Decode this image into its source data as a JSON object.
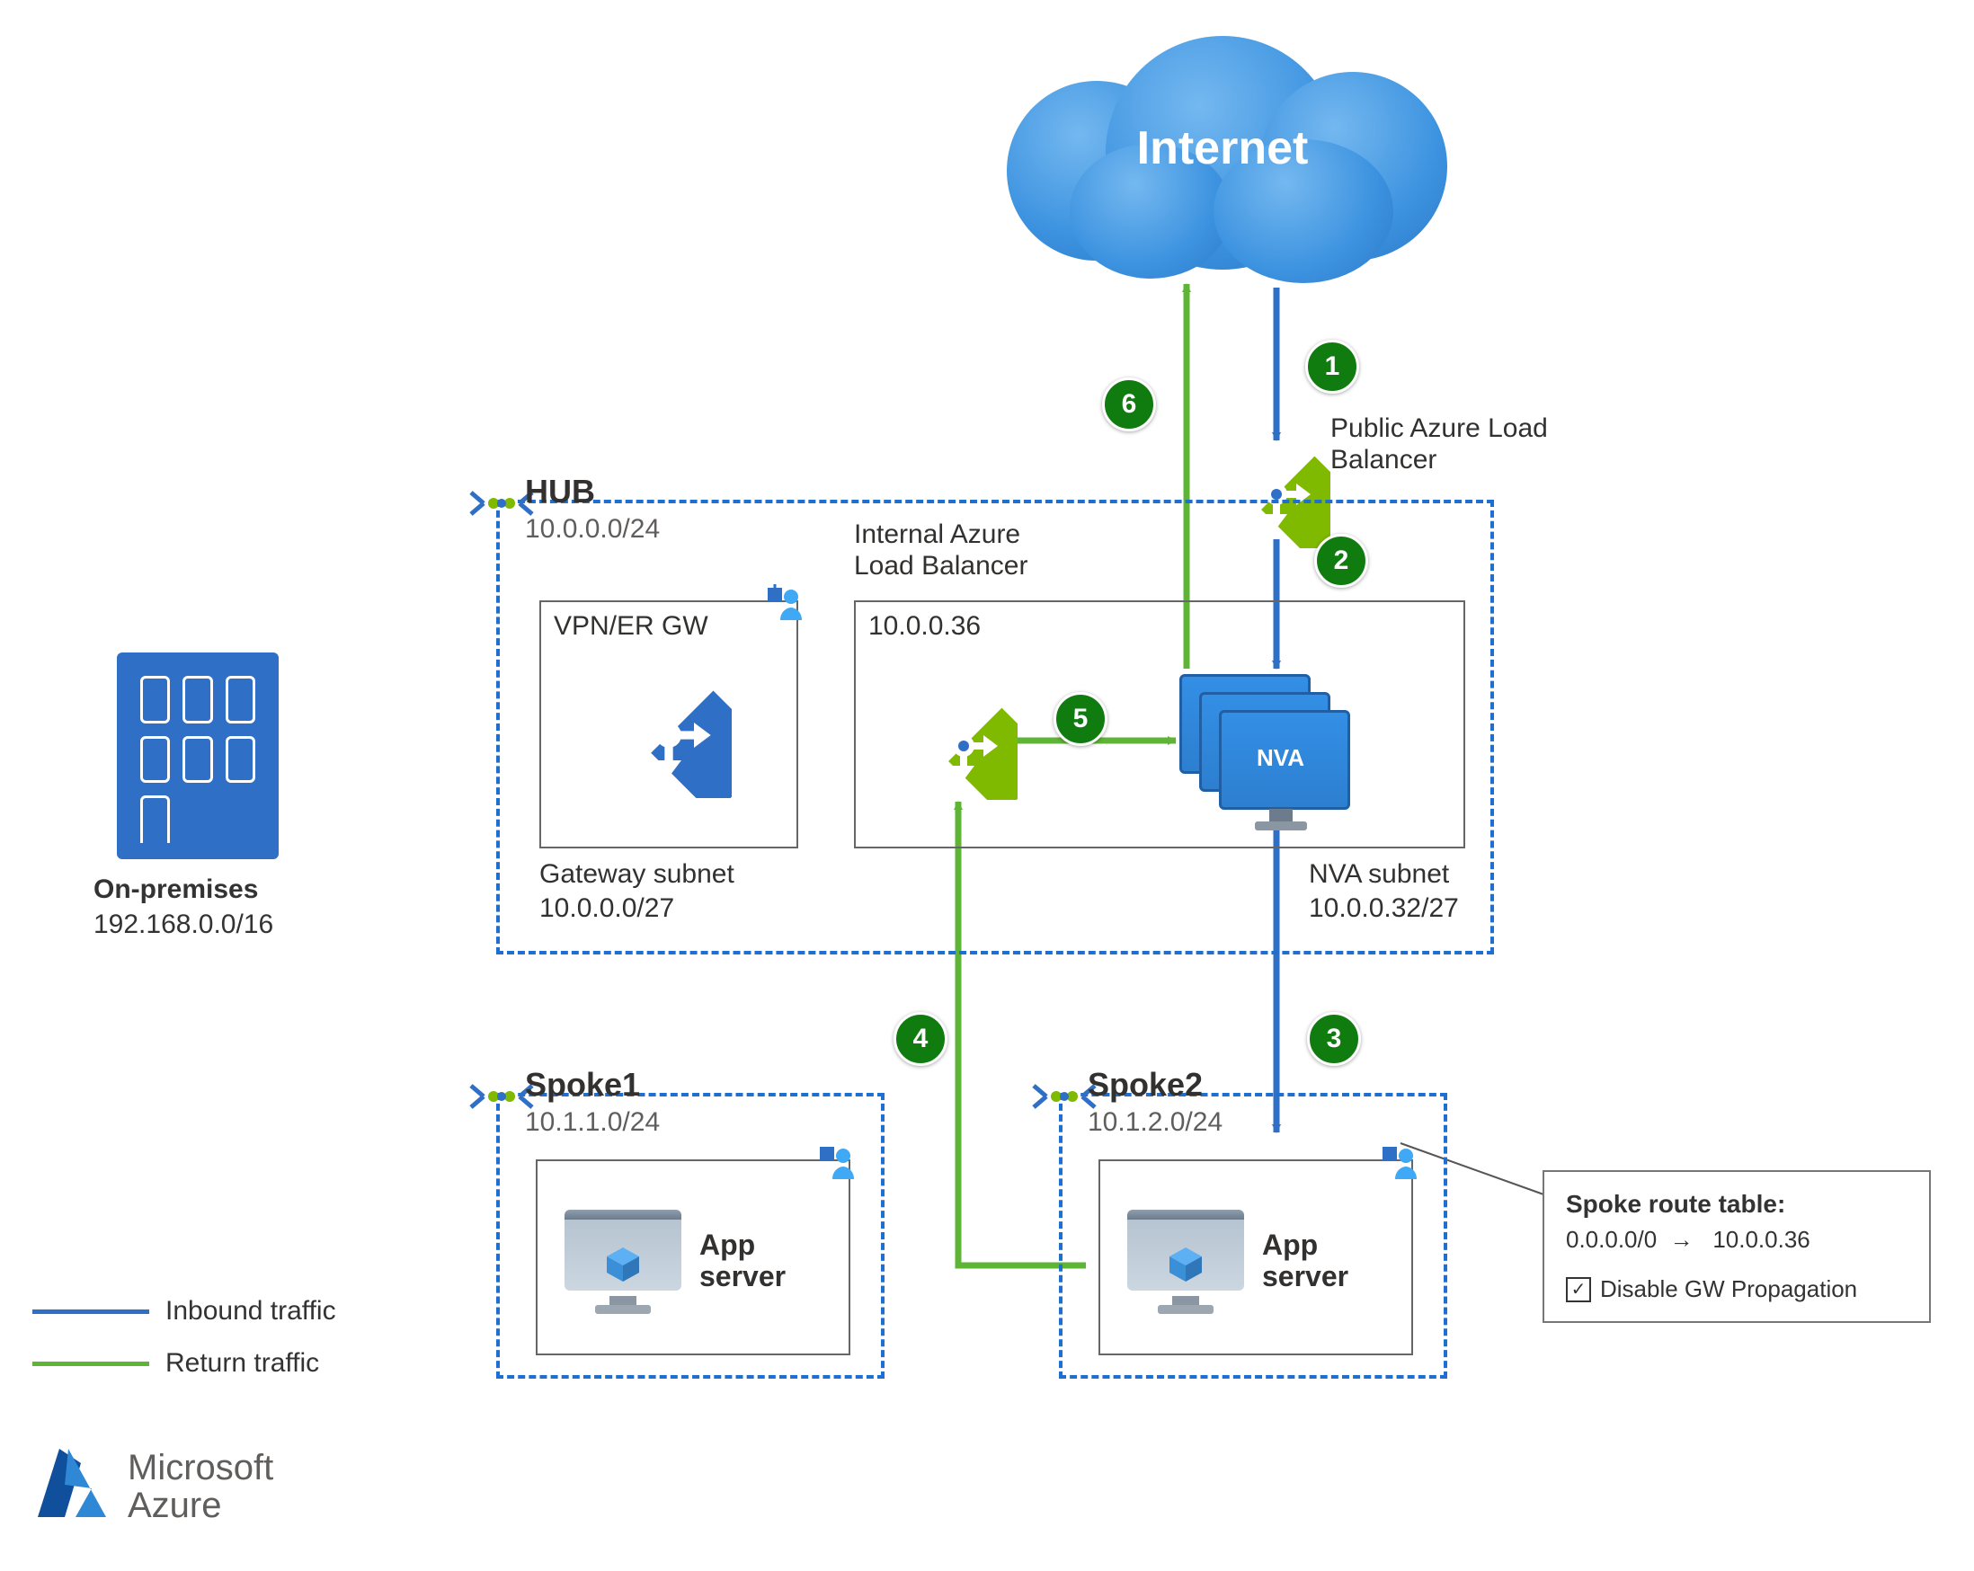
{
  "internet": {
    "label": "Internet"
  },
  "public_lb": {
    "label": "Public Azure Load\nBalancer"
  },
  "internal_lb": {
    "label": "Internal Azure\nLoad Balancer",
    "ip": "10.0.0.36"
  },
  "hub": {
    "title": "HUB",
    "cidr": "10.0.0.0/24",
    "gateway_subnet": {
      "top_label": "VPN/ER GW",
      "name": "Gateway subnet",
      "cidr": "10.0.0.0/27"
    },
    "nva_subnet": {
      "name": "NVA subnet",
      "cidr": "10.0.0.32/27",
      "nva_label": "NVA"
    }
  },
  "spoke1": {
    "title": "Spoke1",
    "cidr": "10.1.1.0/24",
    "app_server": "App\nserver"
  },
  "spoke2": {
    "title": "Spoke2",
    "cidr": "10.1.2.0/24",
    "app_server": "App\nserver"
  },
  "on_prem": {
    "title": "On-premises",
    "cidr": "192.168.0.0/16"
  },
  "route_table_callout": {
    "title": "Spoke route table:",
    "route_prefix": "0.0.0.0/0",
    "route_arrow": "→",
    "route_nexthop": "10.0.0.36",
    "disable_gw": "Disable GW Propagation"
  },
  "legend": {
    "inbound": "Inbound traffic",
    "return": "Return traffic"
  },
  "brand": {
    "line1": "Microsoft",
    "line2": "Azure"
  },
  "steps": {
    "s1": "1",
    "s2": "2",
    "s3": "3",
    "s4": "4",
    "s5": "5",
    "s6": "6"
  }
}
